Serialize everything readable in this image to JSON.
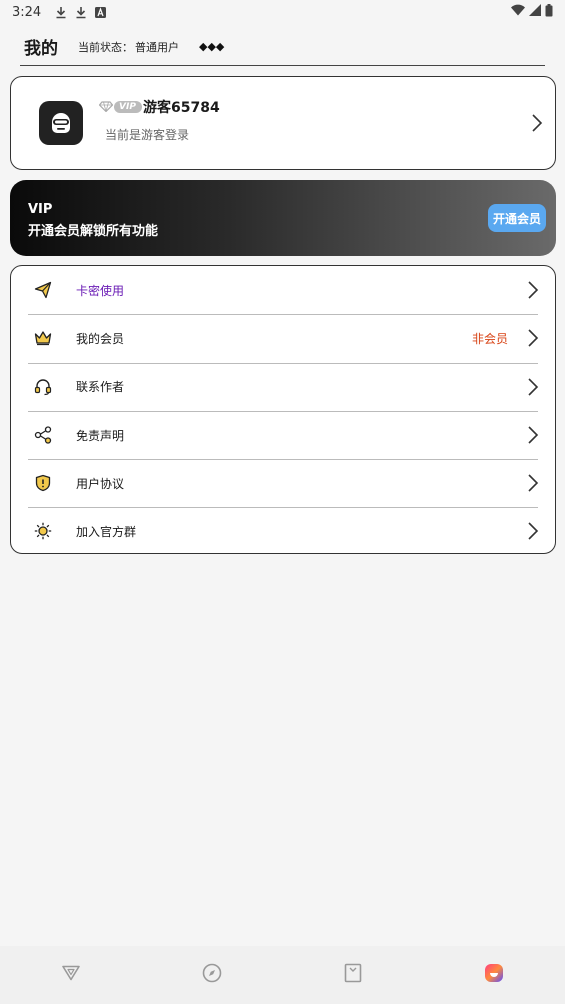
{
  "status_bar": {
    "time": "3:24",
    "left_icons": [
      "download-icon",
      "download-icon",
      "font-icon"
    ],
    "right_icons": [
      "wifi-icon",
      "signal-icon",
      "battery-icon"
    ]
  },
  "header": {
    "title": "我的",
    "status_label": "当前状态：",
    "status_value": "普通用户",
    "diamonds": "◆◆◆"
  },
  "profile": {
    "vip_tag": "VIP",
    "username": "游客65784",
    "login_state": "当前是游客登录",
    "avatar_icon": "robot-avatar-icon"
  },
  "vip_banner": {
    "title": "VIP",
    "description": "开通会员解锁所有功能",
    "button_label": "开通会员",
    "button_color": "#5aa8f0"
  },
  "menu": {
    "items": [
      {
        "label": "卡密使用",
        "icon": "paper-plane-icon",
        "value": ""
      },
      {
        "label": "我的会员",
        "icon": "crown-icon",
        "value": "非会员"
      },
      {
        "label": "联系作者",
        "icon": "headset-icon",
        "value": ""
      },
      {
        "label": "免责声明",
        "icon": "share-icon",
        "value": ""
      },
      {
        "label": "用户协议",
        "icon": "shield-icon",
        "value": ""
      },
      {
        "label": "加入官方群",
        "icon": "sun-icon",
        "value": ""
      }
    ],
    "accent_color": "#6a1bb5",
    "value_color": "#d84315"
  },
  "bottom_nav": {
    "tabs": [
      {
        "icon": "v-logo-icon",
        "active": false
      },
      {
        "icon": "compass-icon",
        "active": false
      },
      {
        "icon": "bookmark-icon",
        "active": false
      },
      {
        "icon": "profile-icon",
        "active": true
      }
    ]
  }
}
